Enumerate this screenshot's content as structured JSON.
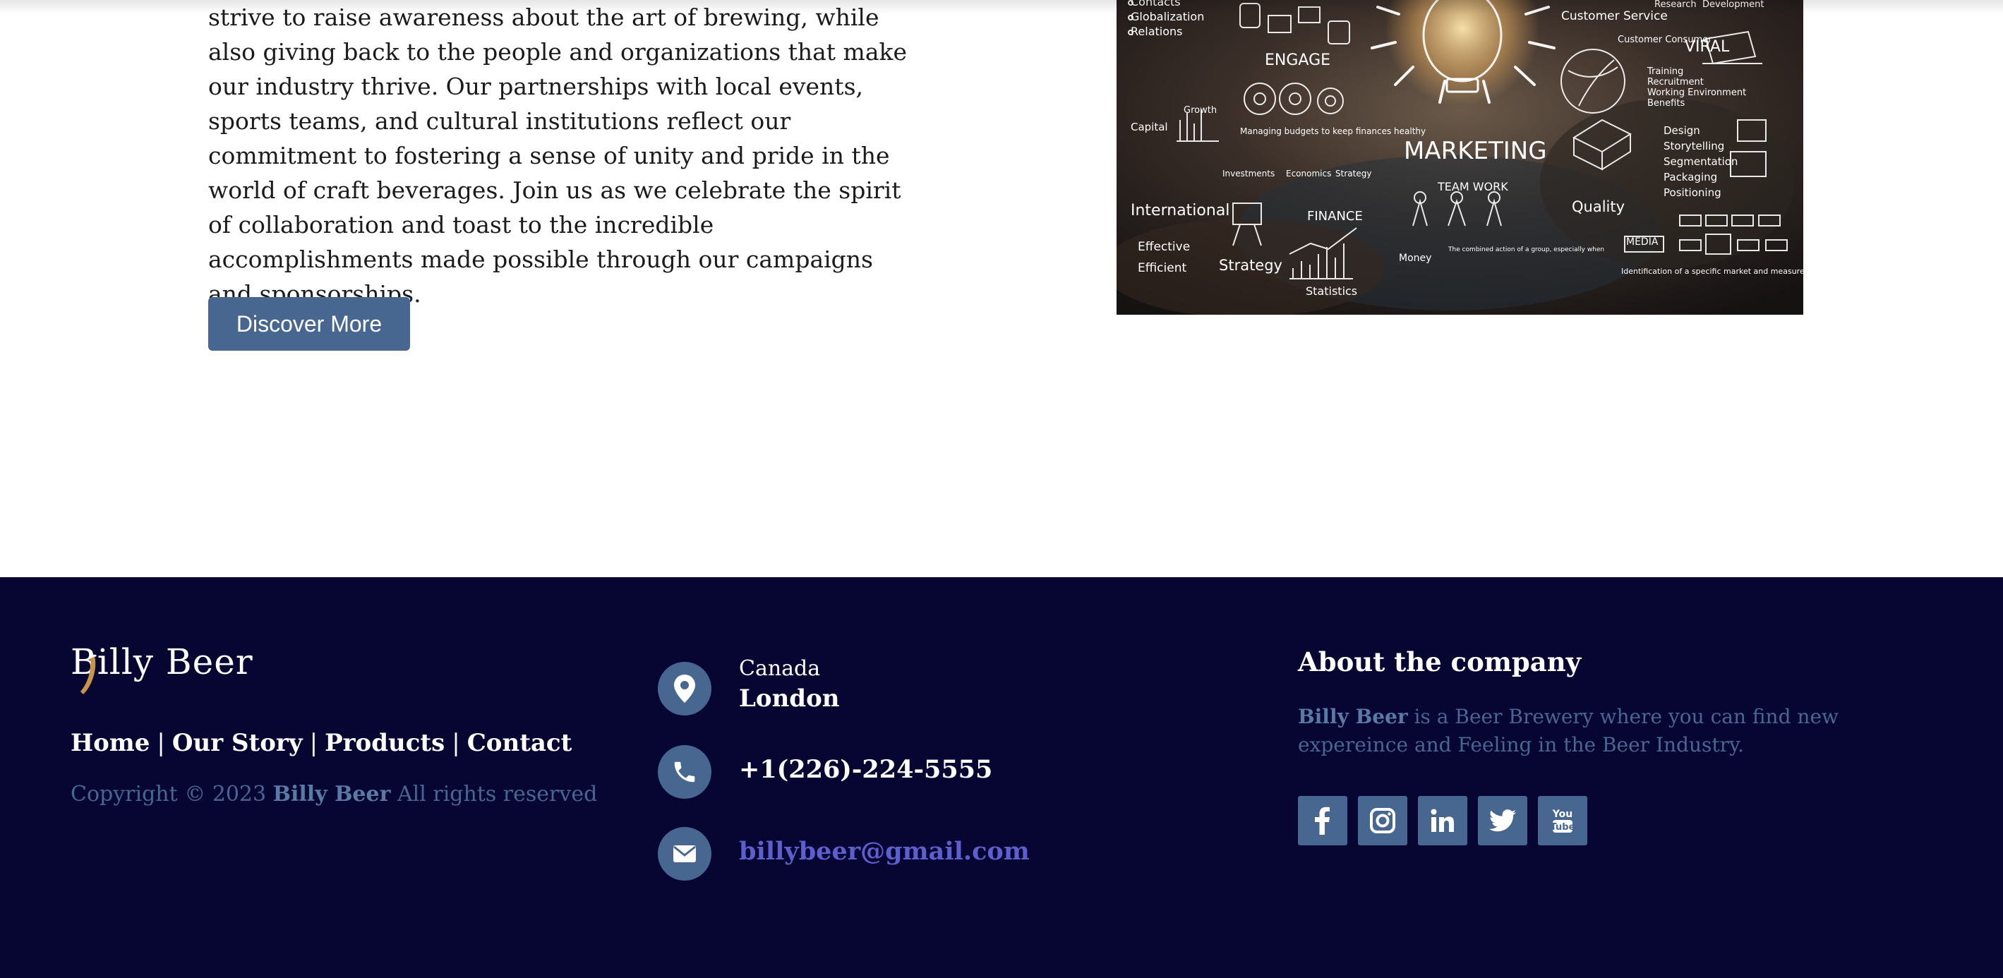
{
  "content": {
    "body_text": "strive to raise awareness about the art of brewing, while also giving back to the people and organizations that make our industry thrive. Our partnerships with local events, sports teams, and cultural institutions reflect our commitment to fostering a sense of unity and pride in the world of craft beverages. Join us as we celebrate the spirit of collaboration and toast to the incredible accomplishments made possible through our campaigns and sponsorships.",
    "button_label": "Discover More",
    "image": {
      "labels": [
        "Contacts",
        "Globalization",
        "Relations",
        "ENGAGE",
        "Capital",
        "Growth",
        "Managing budgets to keep finances healthy",
        "Investments",
        "Economics",
        "Strategy",
        "International",
        "Effective",
        "Efficient",
        "Strategy",
        "FINANCE",
        "Statistics",
        "MARKETING",
        "TEAM WORK",
        "Money",
        "The combined action of a group, especially when",
        "Customer Service",
        "Customer Consumer",
        "Research",
        "Development",
        "VIRAL",
        "Training",
        "Recruitment",
        "Working Environment",
        "Benefits",
        "Design",
        "Storytelling",
        "Segmentation",
        "Packaging",
        "Positioning",
        "Quality",
        "MEDIA",
        "Identification of a specific market and measurement of its size and other characteristics"
      ]
    }
  },
  "footer": {
    "logo_text": "Billy Beer",
    "nav": [
      "Home",
      "Our Story",
      "Products",
      "Contact"
    ],
    "nav_separator": "|",
    "copyright_prefix": "Copyright © 2023",
    "copyright_brand": "Billy Beer",
    "copyright_suffix": "All rights reserved",
    "contact": {
      "country": "Canada",
      "city": "London",
      "phone": "+1(226)-224-5555",
      "email": "billybeer@gmail.com"
    },
    "about": {
      "heading": "About the company",
      "brand": "Billy Beer",
      "text": "is a Beer Brewery where you can find new expereince and Feeling in the Beer Industry."
    },
    "socials": [
      "facebook-icon",
      "instagram-icon",
      "linkedin-icon",
      "twitter-icon",
      "youtube-icon"
    ]
  },
  "colors": {
    "accent": "#476791",
    "footer_bg": "#070632",
    "email": "#5d5fcf"
  }
}
